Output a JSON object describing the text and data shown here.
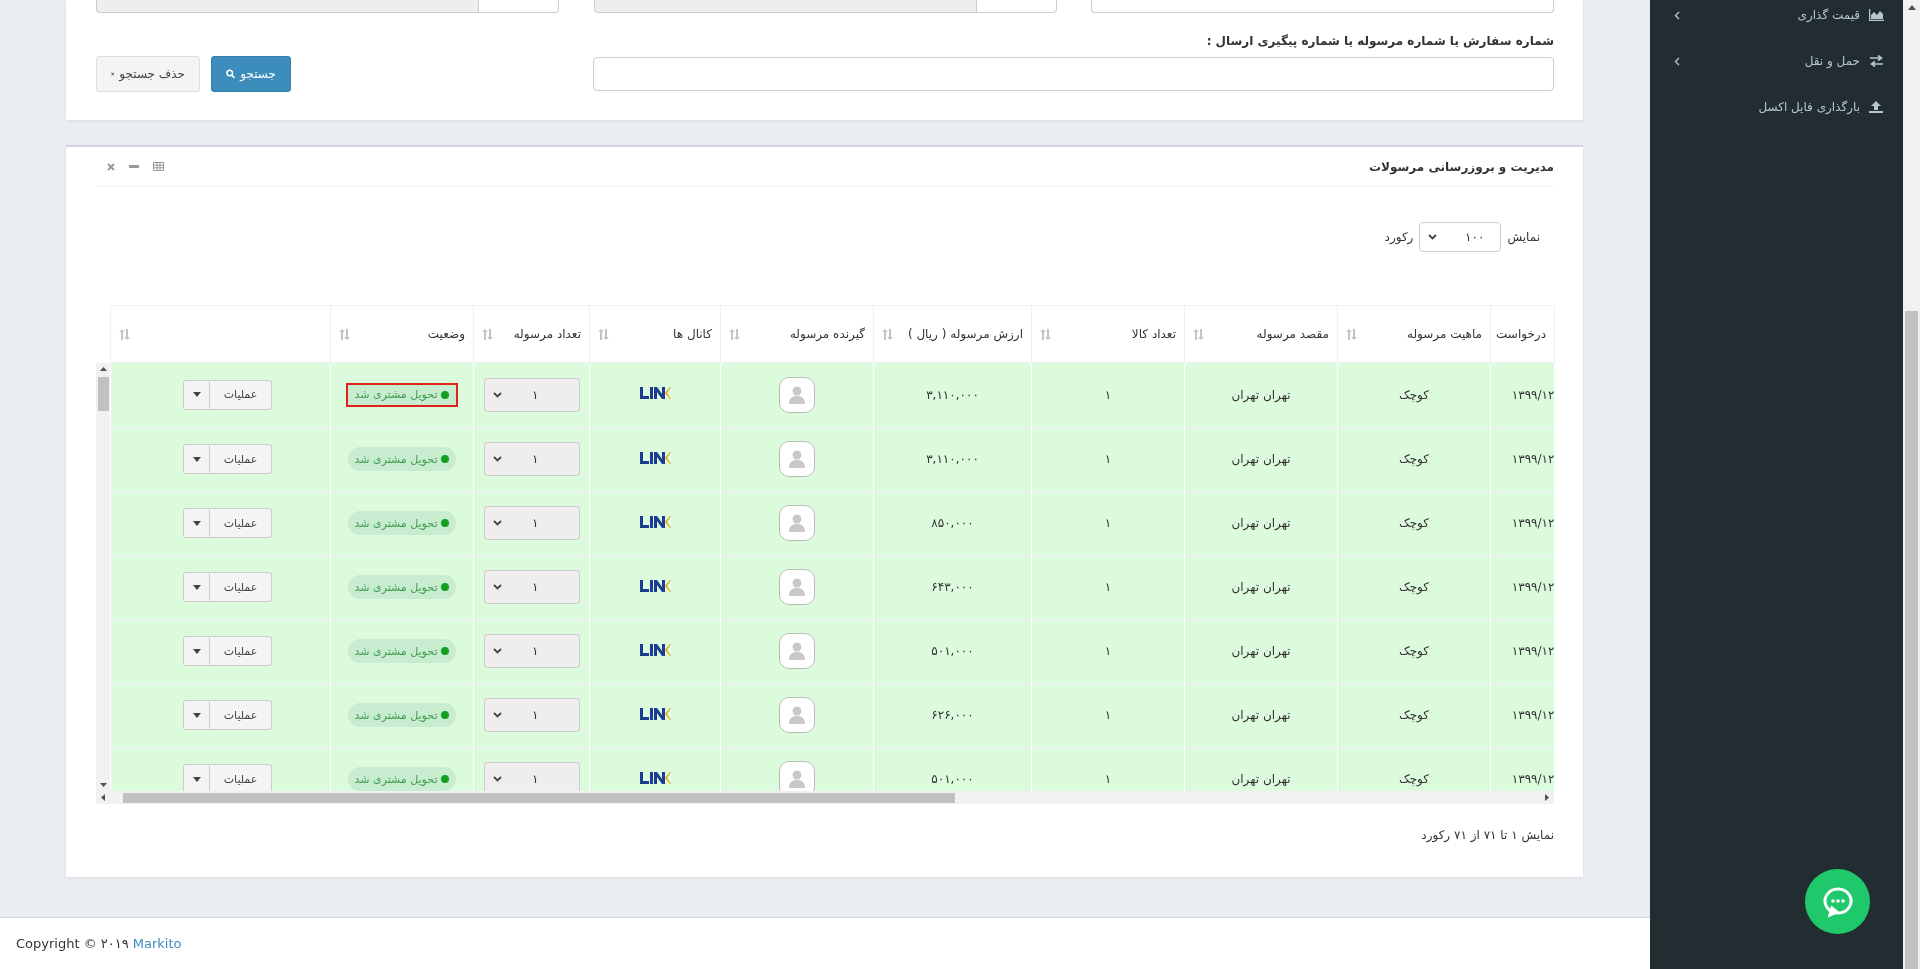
{
  "search": {
    "label": "شماره سفارش یا شماره مرسوله یا شماره پیگیری ارسال :",
    "buttons": [
      {
        "label": "جستجو",
        "kind": "primary"
      },
      {
        "label": "حذف جستجو",
        "kind": "default"
      }
    ]
  },
  "panel": {
    "title": "مدیریت و بروزرسانی مرسولات",
    "length": {
      "prefix": "نمایش",
      "value": "۱۰۰",
      "suffix": "رکورد"
    },
    "table": {
      "columns": [
        {
          "label": "درخواست"
        },
        {
          "label": "ماهیت مرسوله",
          "sortable": true
        },
        {
          "label": "مقصد مرسوله",
          "sortable": true
        },
        {
          "label": "تعداد کالا",
          "sortable": true
        },
        {
          "label": "ارزش مرسوله ( ریال )",
          "sortable": true
        },
        {
          "label": "گیرنده مرسوله",
          "sortable": true
        },
        {
          "label": "کانال ها",
          "sortable": true
        },
        {
          "label": "تعداد مرسوله",
          "sortable": true
        },
        {
          "label": "وضعیت",
          "sortable": true
        },
        {
          "sortable": true
        }
      ],
      "rows": [
        {
          "date": "۱۳۹۹/۱۲",
          "nature": "کوچک",
          "destination": "تهران تهران",
          "items": "۱",
          "value": "۳,۱۱۰,۰۰۰",
          "parcels": "۱",
          "status": "تحویل مشتری شد",
          "action": "عملیات",
          "highlighted": true
        },
        {
          "date": "۱۳۹۹/۱۲",
          "nature": "کوچک",
          "destination": "تهران تهران",
          "items": "۱",
          "value": "۳,۱۱۰,۰۰۰",
          "parcels": "۱",
          "status": "تحویل مشتری شد",
          "action": "عملیات",
          "highlighted": false
        },
        {
          "date": "۱۳۹۹/۱۲",
          "nature": "کوچک",
          "destination": "تهران تهران",
          "items": "۱",
          "value": "۸۵۰,۰۰۰",
          "parcels": "۱",
          "status": "تحویل مشتری شد",
          "action": "عملیات",
          "highlighted": false
        },
        {
          "date": "۱۳۹۹/۱۲",
          "nature": "کوچک",
          "destination": "تهران تهران",
          "items": "۱",
          "value": "۶۴۳,۰۰۰",
          "parcels": "۱",
          "status": "تحویل مشتری شد",
          "action": "عملیات",
          "highlighted": false
        },
        {
          "date": "۱۳۹۹/۱۲",
          "nature": "کوچک",
          "destination": "تهران تهران",
          "items": "۱",
          "value": "۵۰۱,۰۰۰",
          "parcels": "۱",
          "status": "تحویل مشتری شد",
          "action": "عملیات",
          "highlighted": false
        },
        {
          "date": "۱۳۹۹/۱۲",
          "nature": "کوچک",
          "destination": "تهران تهران",
          "items": "۱",
          "value": "۶۲۶,۰۰۰",
          "parcels": "۱",
          "status": "تحویل مشتری شد",
          "action": "عملیات",
          "highlighted": false
        },
        {
          "date": "۱۳۹۹/۱۲",
          "nature": "کوچک",
          "destination": "تهران تهران",
          "items": "۱",
          "value": "۵۰۱,۰۰۰",
          "parcels": "۱",
          "status": "تحویل مشتری شد",
          "action": "عملیات",
          "highlighted": false
        }
      ]
    },
    "info": "نمایش ۱ تا ۷۱ از ۷۱ رکورد"
  },
  "footer": {
    "text": "Copyright © ۲۰۱۹",
    "link": "Markito"
  },
  "sidebar": {
    "items": [
      {
        "label": "قیمت گذاری",
        "kind": "chart",
        "has_submenu": true
      },
      {
        "label": "حمل و نقل",
        "kind": "exchange",
        "has_submenu": true
      },
      {
        "label": "بارگذاری فایل اکسل",
        "kind": "upload",
        "has_submenu": false
      }
    ]
  }
}
